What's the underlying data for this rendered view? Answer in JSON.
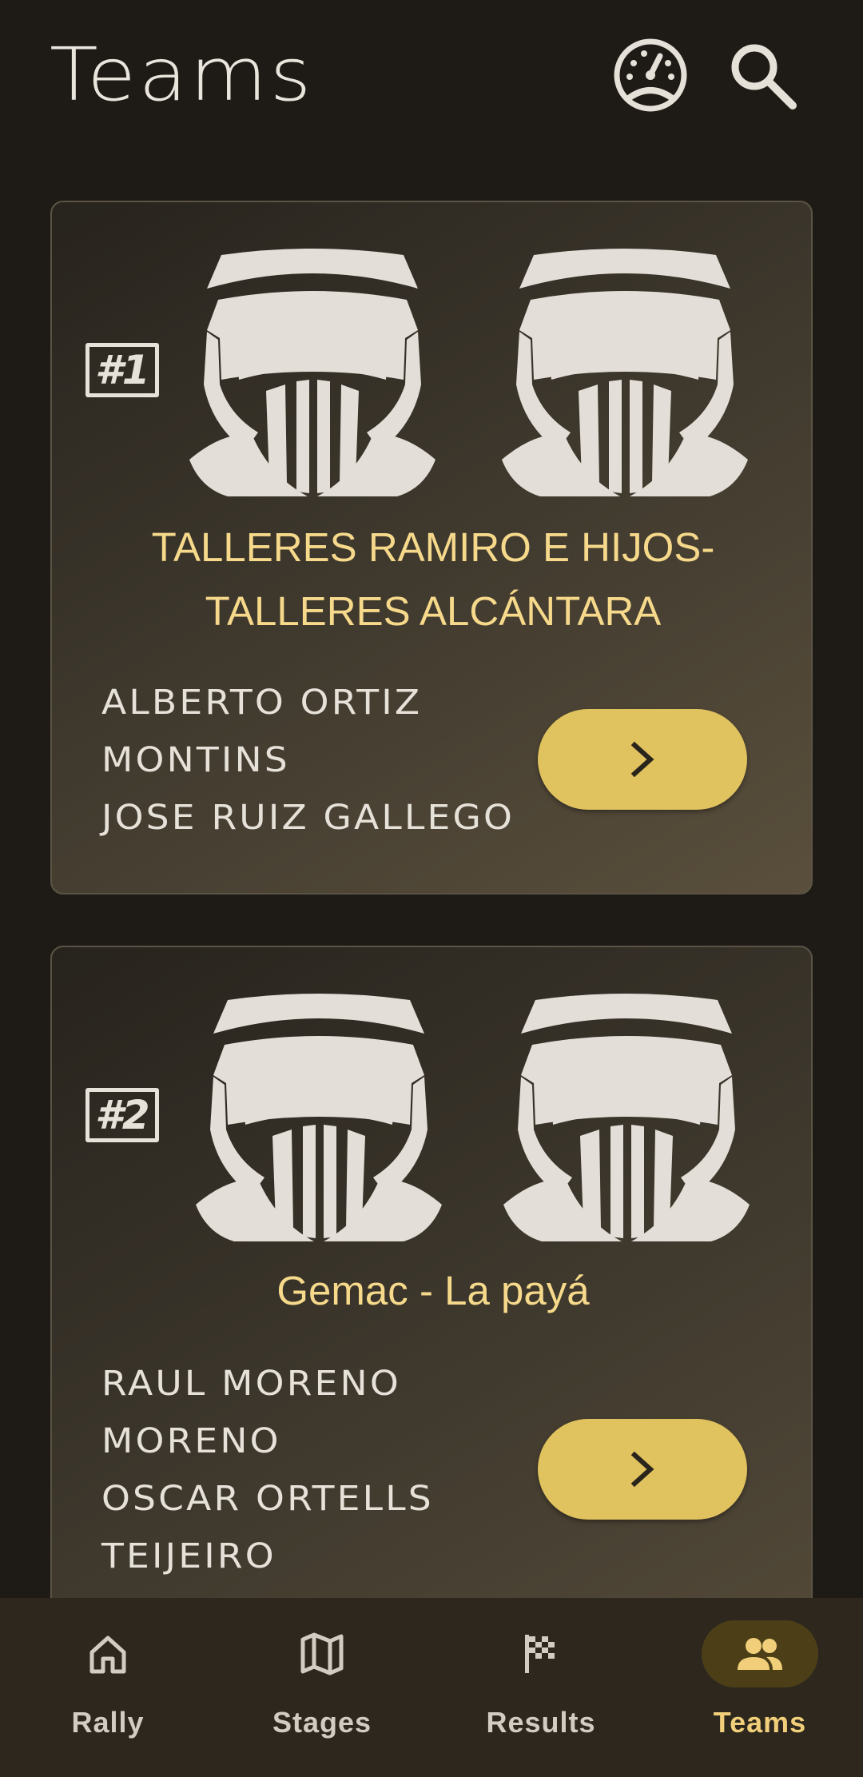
{
  "header": {
    "title": "Teams",
    "icons": [
      "gauge-icon",
      "search-icon"
    ]
  },
  "teams": [
    {
      "rank": "#1",
      "name": "TALLERES RAMIRO E HIJOS-TALLERES ALCÁNTARA",
      "name_lines": [
        "TALLERES RAMIRO E HIJOS-",
        "TALLERES ALCÁNTARA"
      ],
      "drivers_lines": [
        "ALBERTO ORTIZ",
        "MONTINS",
        "JOSE RUIZ GALLEGO"
      ]
    },
    {
      "rank": "#2",
      "name": "Gemac - La payá",
      "name_lines": [
        "Gemac - La payá"
      ],
      "drivers_lines": [
        "RAUL MORENO",
        "MORENO",
        "OSCAR ORTELLS",
        "TEIJEIRO"
      ]
    }
  ],
  "nav": {
    "items": [
      {
        "label": "Rally",
        "icon": "home-icon"
      },
      {
        "label": "Stages",
        "icon": "map-icon"
      },
      {
        "label": "Results",
        "icon": "checkered-flag-icon"
      },
      {
        "label": "Teams",
        "icon": "group-icon",
        "active": true
      }
    ]
  },
  "colors": {
    "background": "#1e1b16",
    "accent": "#e0c25e",
    "team_name": "#f6d98b",
    "active_nav": "#f1cf7a"
  }
}
